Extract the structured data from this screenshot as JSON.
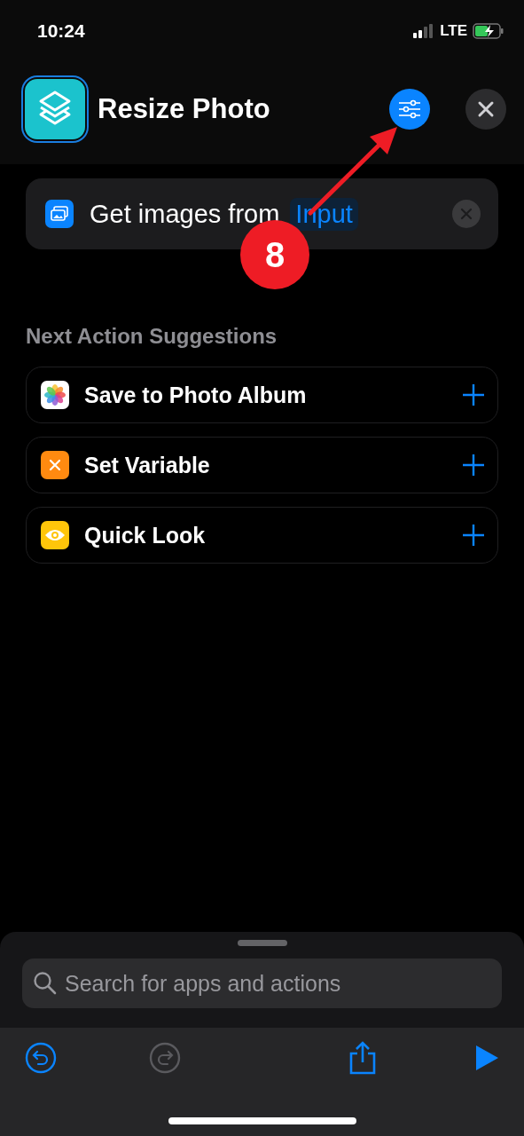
{
  "status_bar": {
    "time": "10:24",
    "network": "LTE"
  },
  "header": {
    "title": "Resize Photo"
  },
  "action": {
    "text": "Get images from",
    "variable": "Input"
  },
  "suggestions": {
    "title": "Next Action Suggestions",
    "items": [
      {
        "kind": "photos",
        "label": "Save to Photo Album"
      },
      {
        "kind": "variable",
        "label": "Set Variable"
      },
      {
        "kind": "quicklook",
        "label": "Quick Look"
      }
    ]
  },
  "search": {
    "placeholder": "Search for apps and actions"
  },
  "toolbar": {
    "undo_disabled": false,
    "redo_disabled": true
  },
  "annotation": {
    "number": "8"
  }
}
